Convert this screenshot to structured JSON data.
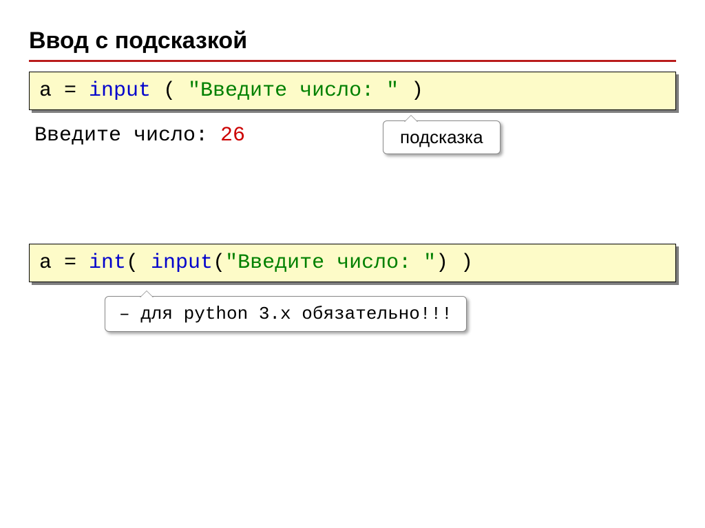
{
  "heading": "Ввод с подсказкой",
  "code1": {
    "a": "a = ",
    "input": "input",
    "paren_open": " ( ",
    "str": "\"Введите число: \"",
    "paren_close": " )"
  },
  "console": {
    "prompt": "Введите число: ",
    "value": "26"
  },
  "callout1": "подсказка",
  "code2": {
    "a": "a = ",
    "int": "int",
    "paren1": "( ",
    "input": "input",
    "paren2": "(",
    "str": "\"Введите число: \"",
    "paren3": ") )"
  },
  "callout2": "– для python 3.x обязательно!!!"
}
